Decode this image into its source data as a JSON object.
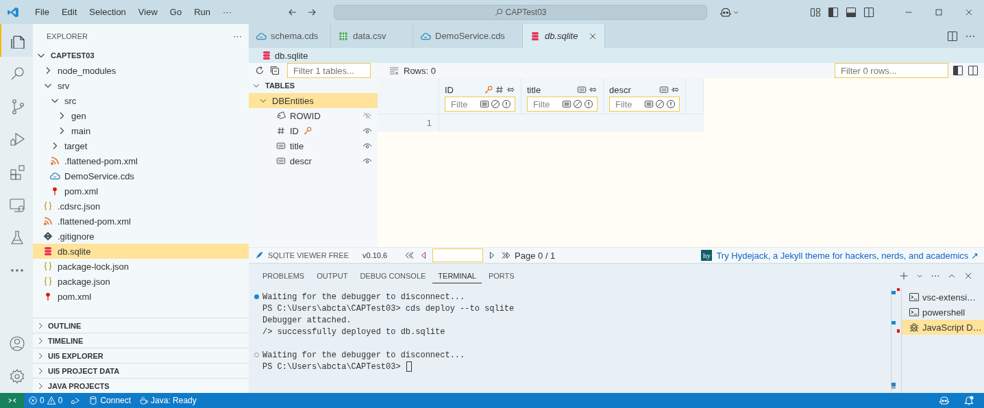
{
  "title_bar": {
    "menu": [
      "File",
      "Edit",
      "Selection",
      "View",
      "Go",
      "Run"
    ],
    "overflow": "···",
    "search": "CAPTest03"
  },
  "activity_bar": {
    "items": [
      {
        "kind": "explorer",
        "selected": true
      },
      {
        "kind": "search",
        "selected": false
      },
      {
        "kind": "source-control",
        "selected": false
      },
      {
        "kind": "run-debug",
        "selected": false
      },
      {
        "kind": "extensions",
        "selected": false
      },
      {
        "kind": "remote",
        "selected": false
      },
      {
        "kind": "testing",
        "selected": false
      },
      {
        "kind": "more",
        "selected": false
      }
    ],
    "bottom": [
      {
        "kind": "account"
      },
      {
        "kind": "settings"
      }
    ]
  },
  "sidebar": {
    "title": "EXPLORER",
    "more": "···",
    "tree": [
      {
        "label": "CAPTEST03",
        "kind": "folder",
        "expanded": true,
        "selected": false,
        "children": [
          {
            "label": "node_modules",
            "kind": "folder",
            "expanded": false,
            "selected": false
          },
          {
            "label": "srv",
            "kind": "folder",
            "expanded": true,
            "selected": false,
            "children": [
              {
                "label": "src",
                "kind": "folder",
                "expanded": true,
                "selected": false,
                "children": [
                  {
                    "label": "gen",
                    "kind": "folder",
                    "expanded": false,
                    "selected": false
                  },
                  {
                    "label": "main",
                    "kind": "folder",
                    "expanded": false,
                    "selected": false
                  }
                ]
              },
              {
                "label": "target",
                "kind": "folder",
                "expanded": false,
                "selected": false
              },
              {
                "label": ".flattened-pom.xml",
                "kind": "xml",
                "selected": false
              },
              {
                "label": "DemoService.cds",
                "kind": "cds",
                "selected": false
              },
              {
                "label": "pom.xml",
                "kind": "pom",
                "selected": false
              }
            ]
          },
          {
            "label": ".cdsrc.json",
            "kind": "json",
            "selected": false
          },
          {
            "label": ".flattened-pom.xml",
            "kind": "xml",
            "selected": false
          },
          {
            "label": ".gitignore",
            "kind": "git",
            "selected": false
          },
          {
            "label": "db.sqlite",
            "kind": "db",
            "selected": true
          },
          {
            "label": "package-lock.json",
            "kind": "json",
            "selected": false
          },
          {
            "label": "package.json",
            "kind": "json",
            "selected": false
          },
          {
            "label": "pom.xml",
            "kind": "pom",
            "selected": false
          }
        ]
      }
    ],
    "sections": [
      {
        "label": "OUTLINE",
        "expanded": false
      },
      {
        "label": "TIMELINE",
        "expanded": false
      },
      {
        "label": "UI5 EXPLORER",
        "expanded": false
      },
      {
        "label": "UI5 PROJECT DATA",
        "expanded": false
      },
      {
        "label": "JAVA PROJECTS",
        "expanded": false
      }
    ]
  },
  "editor": {
    "tabs": [
      {
        "label": "schema.cds",
        "kind": "cds",
        "selected": false,
        "preview": false
      },
      {
        "label": "data.csv",
        "kind": "csv",
        "selected": false,
        "preview": false
      },
      {
        "label": "DemoService.cds",
        "kind": "cds",
        "selected": false,
        "preview": false
      },
      {
        "label": "db.sqlite",
        "kind": "db",
        "selected": true,
        "preview": true
      }
    ],
    "breadcrumb": {
      "label": "db.sqlite",
      "kind": "db"
    }
  },
  "viewer": {
    "table_filter": {
      "placeholder": "Filter 1 tables..."
    },
    "rows_count": "Rows: 0",
    "row_filter": {
      "placeholder": "Filter 0 rows..."
    },
    "tables_heading": "TABLES",
    "tables_expanded": true,
    "tables": [
      {
        "name": "DBEntities",
        "selected": true,
        "expanded": true,
        "columns": [
          {
            "name": "ROWID",
            "kind": "rowid",
            "key": false,
            "visible": false
          },
          {
            "name": "ID",
            "kind": "number",
            "key": true,
            "visible": true
          },
          {
            "name": "title",
            "kind": "text",
            "key": false,
            "visible": true
          },
          {
            "name": "descr",
            "kind": "text",
            "key": false,
            "visible": true
          }
        ]
      }
    ],
    "grid": {
      "columns": [
        {
          "name": "ID",
          "kind": "number",
          "key": true,
          "placeholder": "Filte"
        },
        {
          "name": "title",
          "kind": "text",
          "key": false,
          "placeholder": "Filte"
        },
        {
          "name": "descr",
          "kind": "text",
          "key": false,
          "placeholder": "Filte"
        }
      ],
      "rows": [
        {
          "number": "1"
        }
      ]
    },
    "footer": {
      "brand": "SQLITE VIEWER FREE",
      "version": "v0.10.6",
      "page": "Page 0 / 1",
      "promo_logo": "hy",
      "promo": "Try Hydejack, a Jekyll theme for hackers, nerds, and academics ↗"
    }
  },
  "panel": {
    "tabs": [
      {
        "label": "PROBLEMS",
        "selected": false
      },
      {
        "label": "OUTPUT",
        "selected": false
      },
      {
        "label": "DEBUG CONSOLE",
        "selected": false
      },
      {
        "label": "TERMINAL",
        "selected": true
      },
      {
        "label": "PORTS",
        "selected": false
      }
    ],
    "terminal": {
      "blocks": [
        {
          "succeeded": true,
          "lines": [
            "Waiting for the debugger to disconnect...",
            "PS C:\\Users\\abcta\\CAPTest03> cds deploy --to sqlite",
            "Debugger attached.",
            "/> successfully deployed to db.sqlite"
          ]
        },
        {
          "succeeded": false,
          "lines": [
            "Waiting for the debugger to disconnect...",
            "PS C:\\Users\\abcta\\CAPTest03>"
          ]
        }
      ],
      "cursor": true
    },
    "sessions": [
      {
        "label": "vsc-extensi…",
        "kind": "shell",
        "selected": false
      },
      {
        "label": "powershell",
        "kind": "shell",
        "selected": false
      },
      {
        "label": "JavaScript D…",
        "kind": "debug",
        "selected": true
      }
    ]
  },
  "status_bar": {
    "errors": "0",
    "warnings": "0",
    "connect": "Connect",
    "java": "Java: Ready"
  }
}
